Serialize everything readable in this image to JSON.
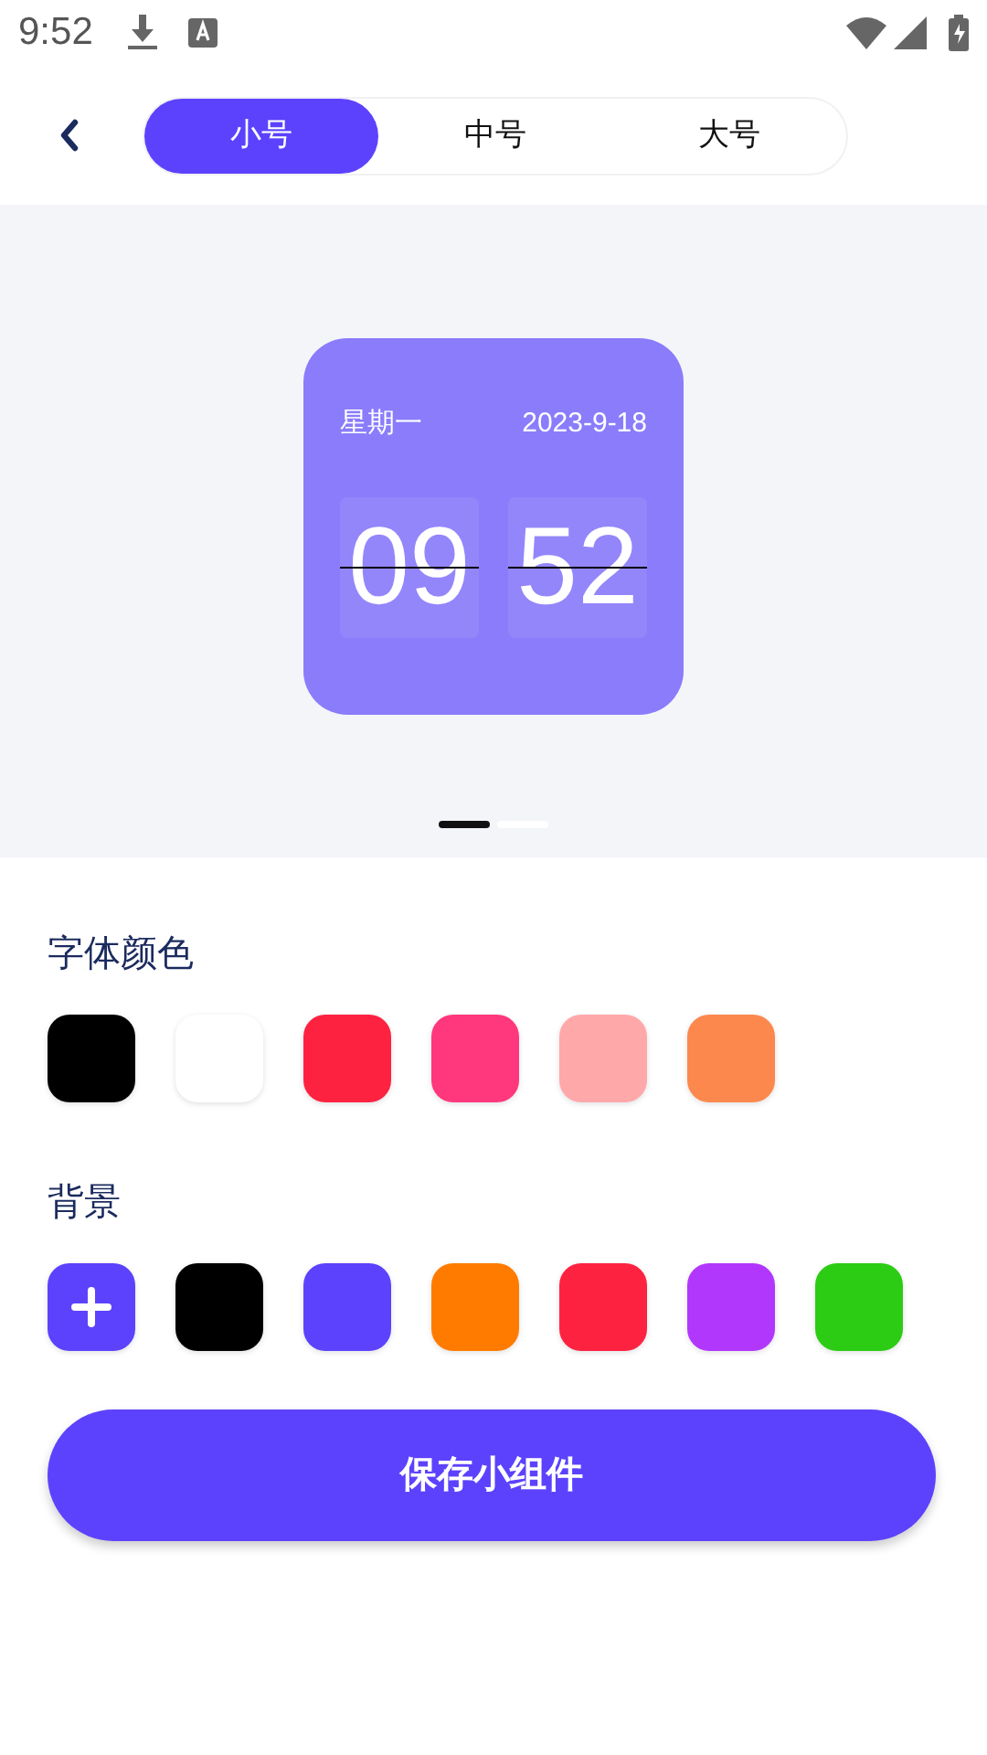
{
  "status_bar": {
    "time": "9:52"
  },
  "tabs": [
    {
      "label": "小号",
      "selected": true
    },
    {
      "label": "中号",
      "selected": false
    },
    {
      "label": "大号",
      "selected": false
    }
  ],
  "widget": {
    "weekday": "星期一",
    "date": "2023-9-18",
    "hours": "09",
    "minutes": "52",
    "color": "#8a7cfb"
  },
  "pager": [
    {
      "selected": true
    },
    {
      "selected": false
    }
  ],
  "font_color": {
    "title": "字体颜色",
    "swatches": [
      {
        "color": "#000000"
      },
      {
        "color": "#ffffff"
      },
      {
        "color": "#fe2241"
      },
      {
        "color": "#ff377c"
      },
      {
        "color": "#ffa8aa"
      },
      {
        "color": "#fc884e"
      }
    ]
  },
  "background": {
    "title": "背景",
    "swatches": [
      {
        "kind": "add",
        "color": "#5c42fd"
      },
      {
        "kind": "color",
        "color": "#000000"
      },
      {
        "kind": "color",
        "color": "#5c42fd"
      },
      {
        "kind": "color",
        "color": "#ff7b00"
      },
      {
        "kind": "color",
        "color": "#fe2241"
      },
      {
        "kind": "color",
        "color": "#b237fd"
      },
      {
        "kind": "color",
        "color": "#2ccc14"
      }
    ]
  },
  "save_button": "保存小组件"
}
